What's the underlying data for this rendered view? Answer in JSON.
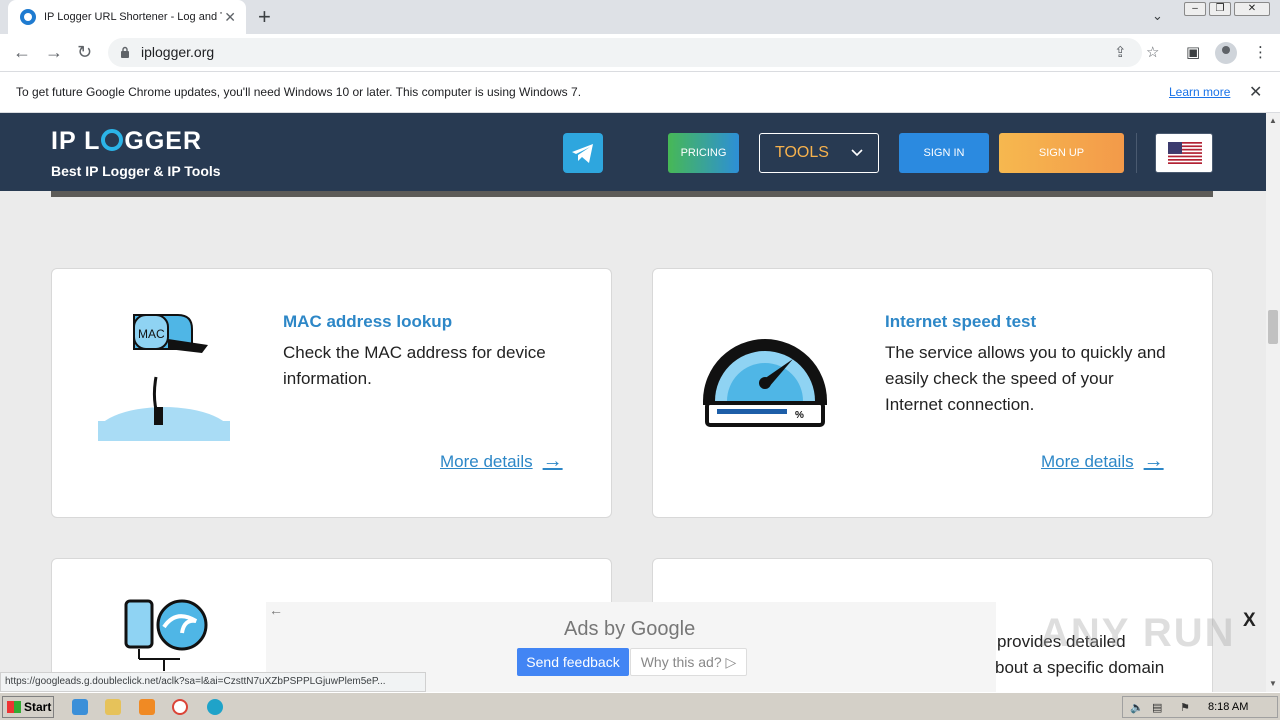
{
  "browser": {
    "tab_title": "IP Logger URL Shortener - Log and T",
    "url": "iplogger.org",
    "new_tab": "+",
    "close_glyph": "✕"
  },
  "infobar": {
    "message": "To get future Google Chrome updates, you'll need Windows 10 or later. This computer is using Windows 7.",
    "link": "Learn more"
  },
  "site": {
    "logo_left": "IP L",
    "logo_right": "GGER",
    "tagline": "Best IP Logger & IP Tools",
    "nav": {
      "pricing": "PRICING",
      "tools": "TOOLS",
      "sign_in": "SIGN IN",
      "sign_up": "SIGN UP"
    }
  },
  "cards": [
    {
      "title": "MAC address lookup",
      "description": "Check the MAC address for device information.",
      "link": "More details",
      "icon_label": "MAC"
    },
    {
      "title": "Internet speed test",
      "description": "The service allows you to quickly and easily check the speed of your Internet connection.",
      "link": "More details",
      "icon_label": "%"
    },
    {
      "partial_text_1": "provides detailed",
      "partial_text_2": "bout a specific domain"
    }
  ],
  "ad": {
    "title": "Ads by Google",
    "send_feedback": "Send feedback",
    "why_this_ad": "Why this ad? ▷",
    "close": "X"
  },
  "watermark": "ANY RUN",
  "status_url": "https://googleads.g.doubleclick.net/aclk?sa=l&ai=CzsttN7uXZbPSPPLGjuwPlem5eP...",
  "taskbar": {
    "start": "Start",
    "time": "8:18 AM"
  },
  "icons": [
    "favicon-icon",
    "back-arrow-icon",
    "forward-arrow-icon",
    "reload-icon",
    "lock-icon",
    "share-icon",
    "star-icon",
    "sidebar-icon",
    "profile-icon",
    "telegram-icon",
    "us-flag-icon",
    "arrow-right-icon",
    "mailbox-icon",
    "speedometer-icon",
    "phone-wave-icon"
  ],
  "colors": {
    "header_bg": "#283a52",
    "accent_blue": "#2d87c7",
    "sign_up_orange": "#f6b84f",
    "tools_text": "#f7b24d"
  }
}
